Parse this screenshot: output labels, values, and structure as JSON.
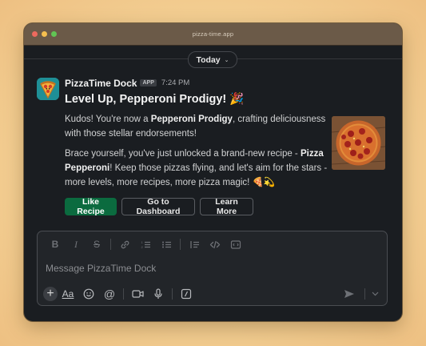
{
  "window": {
    "title": "pizza-time.app",
    "traffic_lights": [
      "#ed6a5e",
      "#f5bf4f",
      "#61c554"
    ]
  },
  "date_divider": {
    "label": "Today",
    "chevron_icon": "chevron-down-icon"
  },
  "message": {
    "sender": "PizzaTime Dock",
    "badge": "APP",
    "time": "7:24 PM",
    "headline": "Level Up, Pepperoni Prodigy!",
    "headline_emoji": "🎉",
    "p1_prefix": "Kudos! You're now a ",
    "p1_bold": "Pepperoni Prodigy",
    "p1_suffix": ", crafting deliciousness with those stellar endorsements!",
    "p2_prefix": "Brace yourself, you've just unlocked a brand-new recipe - ",
    "p2_bold": "Pizza Pepperoni",
    "p2_suffix": "! Keep those pizzas flying, and let's aim for the stars - more levels, more recipes, more pizza magic!",
    "p2_emojis": "🍕💫",
    "image_icon": "pepperoni-pizza-image"
  },
  "actions": {
    "like_recipe": "Like Recipe",
    "go_to_dashboard": "Go to Dashboard",
    "learn_more": "Learn More"
  },
  "composer": {
    "placeholder": "Message PizzaTime Dock",
    "format_icons": [
      "bold-icon",
      "italic-icon",
      "strikethrough-icon",
      "link-icon",
      "ordered-list-icon",
      "bulleted-list-icon",
      "blockquote-icon",
      "code-icon",
      "code-block-icon"
    ],
    "tool_icons": [
      "plus-icon",
      "text-format-icon",
      "emoji-icon",
      "mention-icon",
      "video-icon",
      "microphone-icon",
      "slash-command-icon",
      "send-icon",
      "chevron-down-icon"
    ]
  },
  "colors": {
    "accent_green": "#0b6b3f",
    "window_bg": "#1a1d21",
    "titlebar": "#6b5a48"
  }
}
